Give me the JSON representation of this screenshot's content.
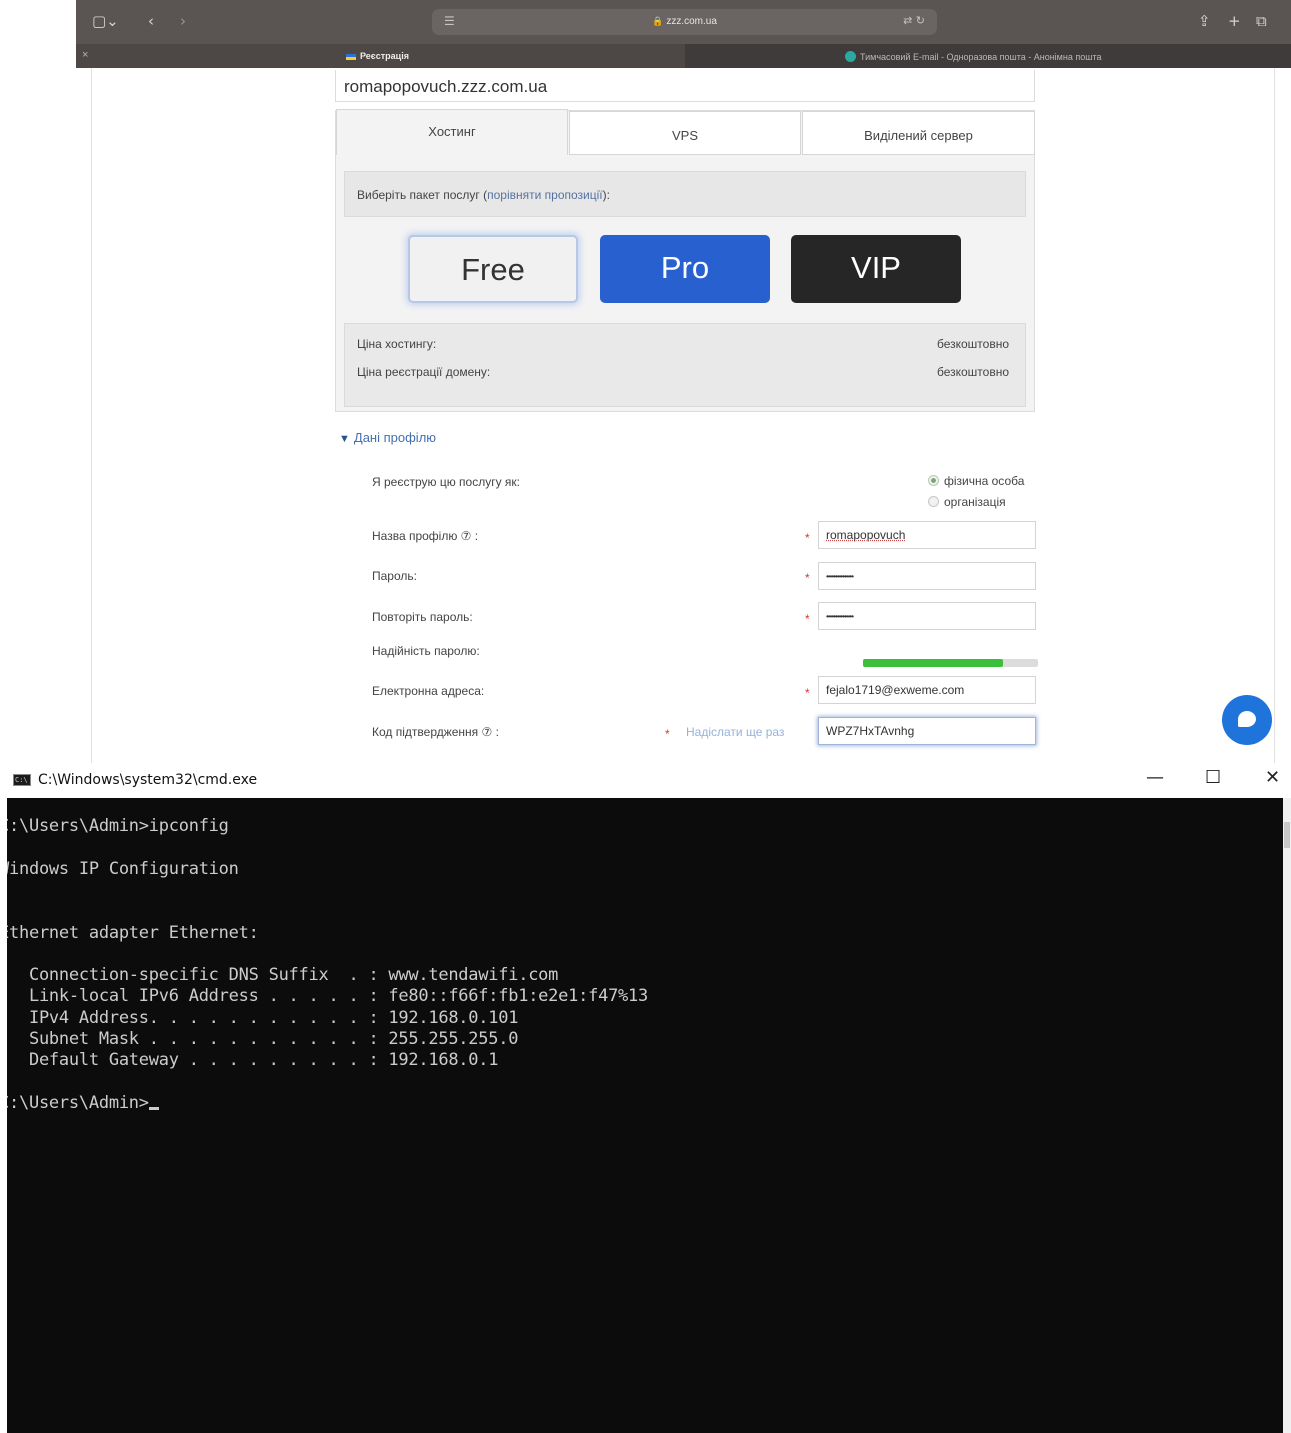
{
  "browser": {
    "url": "zzz.com.ua",
    "tabs": [
      {
        "label": "Реєстрація",
        "active": true
      },
      {
        "label": "Тимчасовий E-mail - Одноразова пошта - Анонімна пошта",
        "active": false
      }
    ]
  },
  "page": {
    "domain": "romapopovuch.zzz.com.ua",
    "service_tabs": [
      "Хостинг",
      "VPS",
      "Виділений сервер"
    ],
    "plan_prompt": "Виберіть пакет послуг",
    "plan_compare_link": "порівняти пропозиції",
    "plans": [
      "Free",
      "Pro",
      "VIP"
    ],
    "prices": [
      {
        "label": "Ціна хостингу:",
        "value": "безкоштовно"
      },
      {
        "label": "Ціна реєстрації домену:",
        "value": "безкоштовно"
      }
    ],
    "profile_toggle": "Дані профілю",
    "form": {
      "register_as_label": "Я реєструю цю послугу як:",
      "register_as_options": [
        {
          "label": "фізична особа",
          "selected": true
        },
        {
          "label": "організація",
          "selected": false
        }
      ],
      "profile_name_label": "Назва профілю ⑦ :",
      "profile_name_value": "romapopovuch",
      "password_label": "Пароль:",
      "password_value": "•••••••••••••••",
      "repeat_password_label": "Повторіть пароль:",
      "repeat_password_value": "•••••••••••••••",
      "strength_label": "Надійність паролю:",
      "strength_fraction": 0.8,
      "email_label": "Електронна адреса:",
      "email_value": "fejalo1719@exweme.com",
      "code_label": "Код підтвердження ⑦ :",
      "resend_label": "Надіслати ще раз",
      "code_value": "WPZ7HxTAvnhg",
      "required_mark": "*"
    }
  },
  "cmd": {
    "title": "C:\\Windows\\system32\\cmd.exe",
    "icon_label": "C:\\",
    "lines": [
      "C:\\Users\\Admin>ipconfig",
      "",
      "Windows IP Configuration",
      "",
      "",
      "Ethernet adapter Ethernet:",
      "",
      "   Connection-specific DNS Suffix  . : www.tendawifi.com",
      "   Link-local IPv6 Address . . . . . : fe80::f66f:fb1:e2e1:f47%13",
      "   IPv4 Address. . . . . . . . . . . : 192.168.0.101",
      "   Subnet Mask . . . . . . . . . . . : 255.255.255.0",
      "   Default Gateway . . . . . . . . . : 192.168.0.1",
      "",
      "C:\\Users\\Admin>"
    ]
  },
  "colors": {
    "pro_blue": "#2860cf",
    "vip_dark": "#262626",
    "link_blue": "#4470b0",
    "strength_green": "#3cbf3c",
    "chat_blue": "#1f74dc"
  }
}
